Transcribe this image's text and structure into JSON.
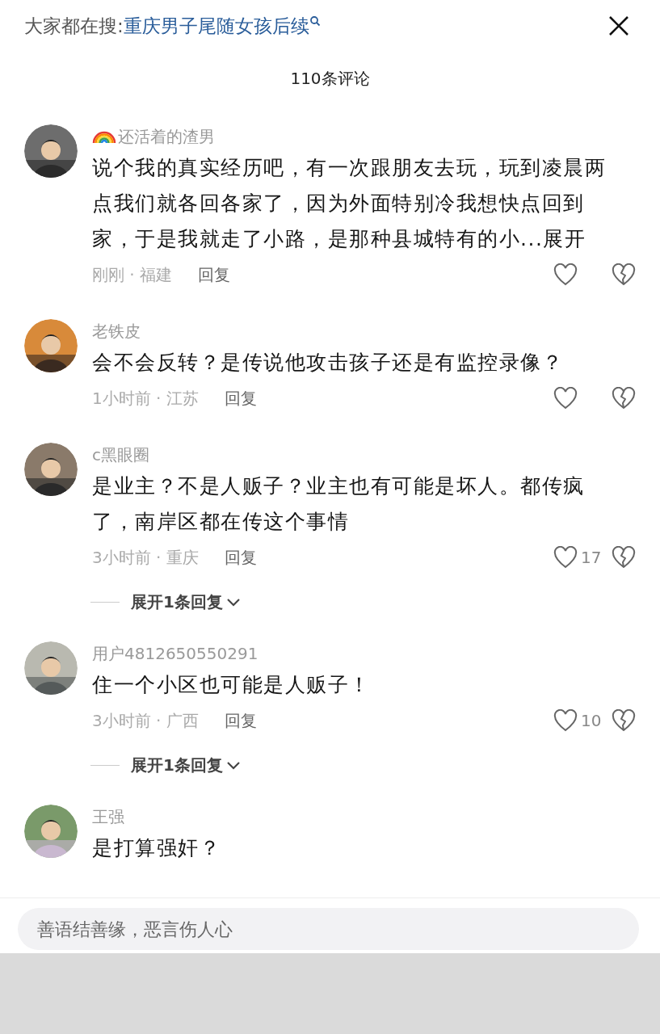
{
  "search_bar": {
    "label": "大家都在搜:",
    "query": "重庆男子尾随女孩后续"
  },
  "title": "110条评论",
  "comments": [
    {
      "username": "还活着的渣男",
      "rainbow_badge": true,
      "body": "说个我的真实经历吧，有一次跟朋友去玩，玩到凌晨两点我们就各回各家了，因为外面特别冷我想快点回到家，于是我就走了小路，是那种县城特有的小...",
      "expand": "展开",
      "meta": "刚刚 · 福建",
      "reply": "回复",
      "liked": false
    },
    {
      "username": "老铁皮",
      "rainbow_badge": false,
      "body": "会不会反转？是传说他攻击孩子还是有监控录像？",
      "meta": "1小时前 · 江苏",
      "reply": "回复",
      "liked": false
    },
    {
      "username": "c黑眼圈",
      "rainbow_badge": false,
      "body": "是业主？不是人贩子？业主也有可能是坏人。都传疯了，南岸区都在传这个事情",
      "meta": "3小时前 · 重庆",
      "reply": "回复",
      "liked": false,
      "likes": "17",
      "replies_link": "展开1条回复"
    },
    {
      "username": "用户4812650550291",
      "rainbow_badge": false,
      "body": "住一个小区也可能是人贩子！",
      "meta": "3小时前 · 广西",
      "reply": "回复",
      "liked": false,
      "likes": "10",
      "replies_link": "展开1条回复"
    },
    {
      "username": "王强",
      "rainbow_badge": false,
      "body": "是打算强奸？"
    }
  ],
  "comment_input": {
    "placeholder": "善语结善缘，恶言伤人心"
  }
}
